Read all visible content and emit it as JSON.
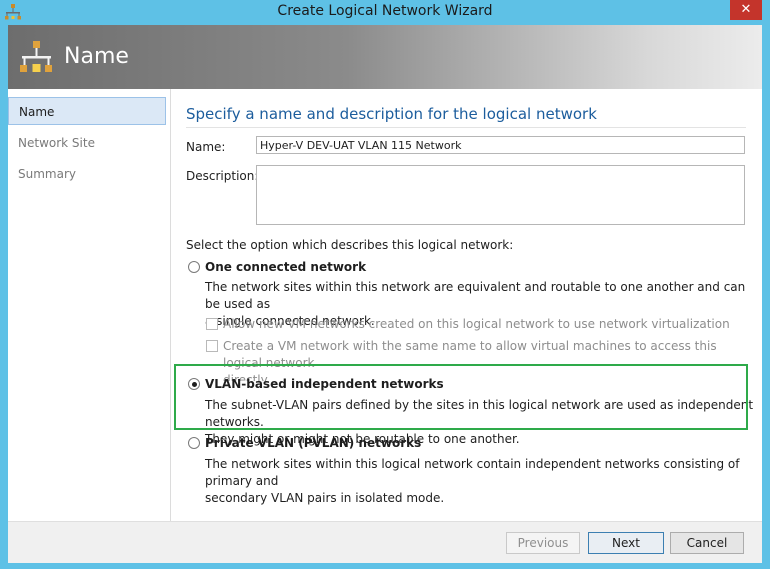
{
  "window": {
    "title": "Create Logical Network Wizard",
    "close_glyph": "✕",
    "icon": "network-wizard-icon"
  },
  "header": {
    "title": "Name",
    "icon": "network-wizard-icon"
  },
  "nav": {
    "items": [
      {
        "label": "Name",
        "active": true
      },
      {
        "label": "Network Site",
        "active": false
      },
      {
        "label": "Summary",
        "active": false
      }
    ]
  },
  "form": {
    "heading": "Specify a name and description for the logical network",
    "name_label": "Name:",
    "name_value": "Hyper-V DEV-UAT VLAN 115 Network",
    "description_label": "Description:",
    "description_value": "",
    "option_prompt": "Select the option which describes this logical network:",
    "options": [
      {
        "label": "One connected network",
        "selected": false,
        "description_line1": "The network sites within this network are equivalent and routable to one another and can be used as",
        "description_line2": "a single connected network.",
        "sub_options": [
          {
            "label": "Allow new VM networks created on this logical network to use network virtualization",
            "checked": false,
            "enabled": false
          },
          {
            "label_line1": "Create a VM network with the same name to allow virtual machines to access this logical network",
            "label_line2": "directly",
            "checked": false,
            "enabled": false
          }
        ]
      },
      {
        "label": "VLAN-based independent networks",
        "selected": true,
        "description_line1": "The subnet-VLAN pairs defined by the sites in this logical network are used as independent networks.",
        "description_line2": "They might or might not be routable to one another."
      },
      {
        "label": "Private VLAN (PVLAN) networks",
        "selected": false,
        "description_line1": "The network sites within this logical network contain independent networks consisting of primary and",
        "description_line2": "secondary VLAN pairs in isolated mode."
      }
    ]
  },
  "footer": {
    "previous_label": "Previous",
    "next_label": "Next",
    "cancel_label": "Cancel"
  },
  "colors": {
    "window_frame": "#5ec1e6",
    "heading": "#1c5d9d",
    "highlight": "#2eaa4a",
    "close_button": "#c4342b"
  }
}
